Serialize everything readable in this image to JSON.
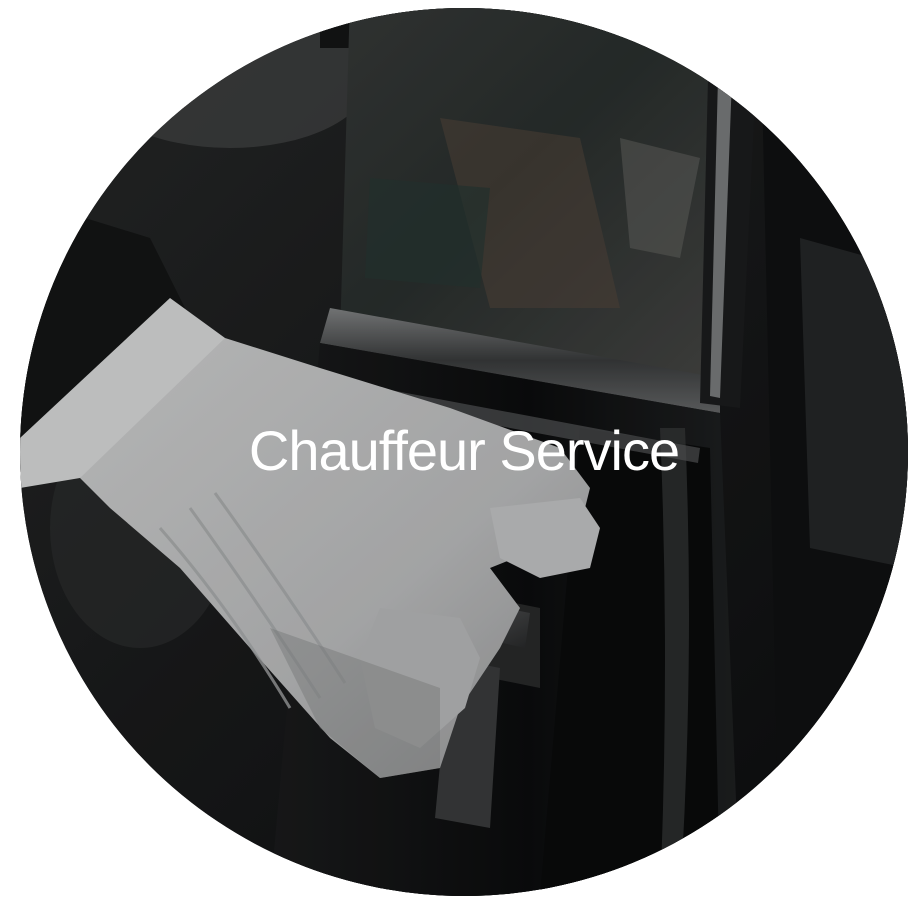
{
  "tile": {
    "title": "Chauffeur Service",
    "image_subject": "gloved-hand-opening-car-door"
  },
  "colors": {
    "overlay_text": "#ffffff",
    "car_body": "#121314",
    "glove": "#d9dadb",
    "background": "#ffffff"
  }
}
